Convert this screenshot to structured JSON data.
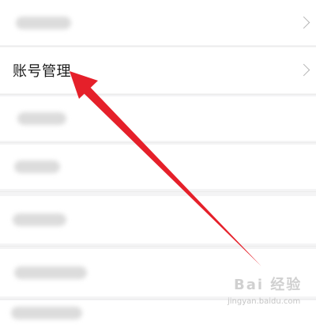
{
  "settings_list": {
    "account_row_label": "账号管理",
    "rows": [
      "",
      "账号管理",
      "",
      "",
      "",
      "",
      ""
    ],
    "chevron_icon": "chevron-right-icon"
  },
  "annotation": {
    "arrow_color": "#e5202a"
  },
  "watermark": {
    "brand": "Bai 经验",
    "url": "jingyan.baidu.com"
  }
}
